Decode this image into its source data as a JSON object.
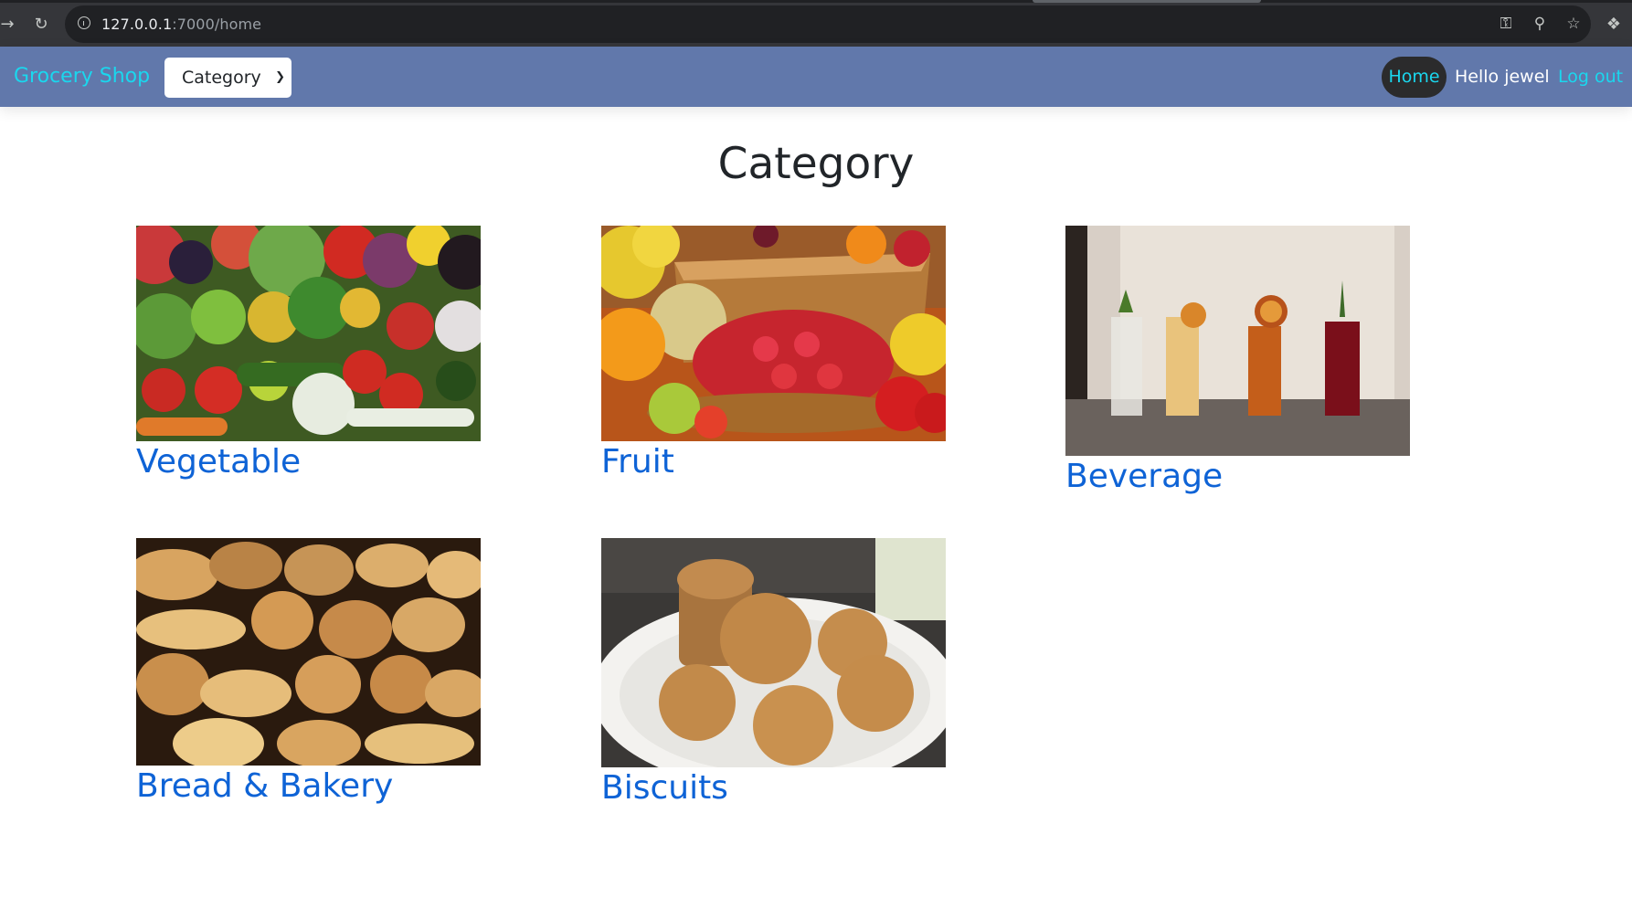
{
  "browser": {
    "url_host": "127.0.0.1",
    "url_path": ":7000/home"
  },
  "navbar": {
    "brand": "Grocery Shop",
    "category_select": "Category",
    "home": "Home",
    "greeting": "Hello jewel",
    "logout": "Log out"
  },
  "page": {
    "title": "Category"
  },
  "categories": [
    {
      "name": "Vegetable"
    },
    {
      "name": "Fruit"
    },
    {
      "name": "Beverage"
    },
    {
      "name": "Bread & Bakery"
    },
    {
      "name": "Biscuits"
    }
  ],
  "colors": {
    "navbar_bg": "#6178ab",
    "accent_cyan": "#1ad7ee",
    "link_blue": "#0e63d6",
    "home_pill": "#2b2b2c"
  }
}
